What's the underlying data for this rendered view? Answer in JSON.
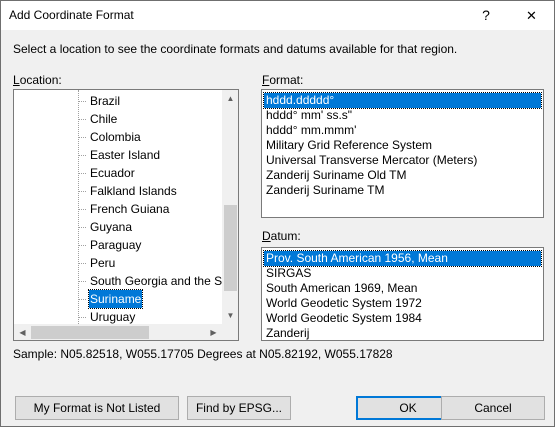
{
  "window": {
    "title": "Add Coordinate Format",
    "help_glyph": "?",
    "close_glyph": "✕"
  },
  "instruction": "Select a location to see the coordinate formats and datums available for that region.",
  "location": {
    "label_prefix": "",
    "label_mnemonic": "L",
    "label_rest": "ocation:",
    "items": [
      "Brazil",
      "Chile",
      "Colombia",
      "Easter Island",
      "Ecuador",
      "Falkland Islands",
      "French Guiana",
      "Guyana",
      "Paraguay",
      "Peru",
      "South Georgia and the South Sandwich Islands",
      "Suriname",
      "Uruguay"
    ],
    "selected": "Suriname"
  },
  "format": {
    "label_mnemonic": "F",
    "label_rest": "ormat:",
    "items": [
      "hddd.ddddd°",
      "hddd° mm' ss.s\"",
      "hddd° mm.mmm'",
      "Military Grid Reference System",
      "Universal Transverse Mercator (Meters)",
      "Zanderij Suriname Old TM",
      "Zanderij Suriname TM"
    ],
    "selected": "hddd.ddddd°"
  },
  "datum": {
    "label_mnemonic": "D",
    "label_rest": "atum:",
    "items": [
      "Prov. South American 1956, Mean",
      "SIRGAS",
      "South American 1969, Mean",
      "World Geodetic System 1972",
      "World Geodetic System 1984",
      "Zanderij"
    ],
    "selected": "Prov. South American 1956, Mean"
  },
  "sample": "Sample: N05.82518, W055.17705 Degrees at N05.82192, W055.17828",
  "buttons": {
    "not_listed": "My Format is Not Listed",
    "find_epsg": "Find by EPSG...",
    "ok": "OK",
    "cancel": "Cancel"
  },
  "colors": {
    "selection": "#0078d7",
    "dialog_bg": "#f0f0f0"
  }
}
